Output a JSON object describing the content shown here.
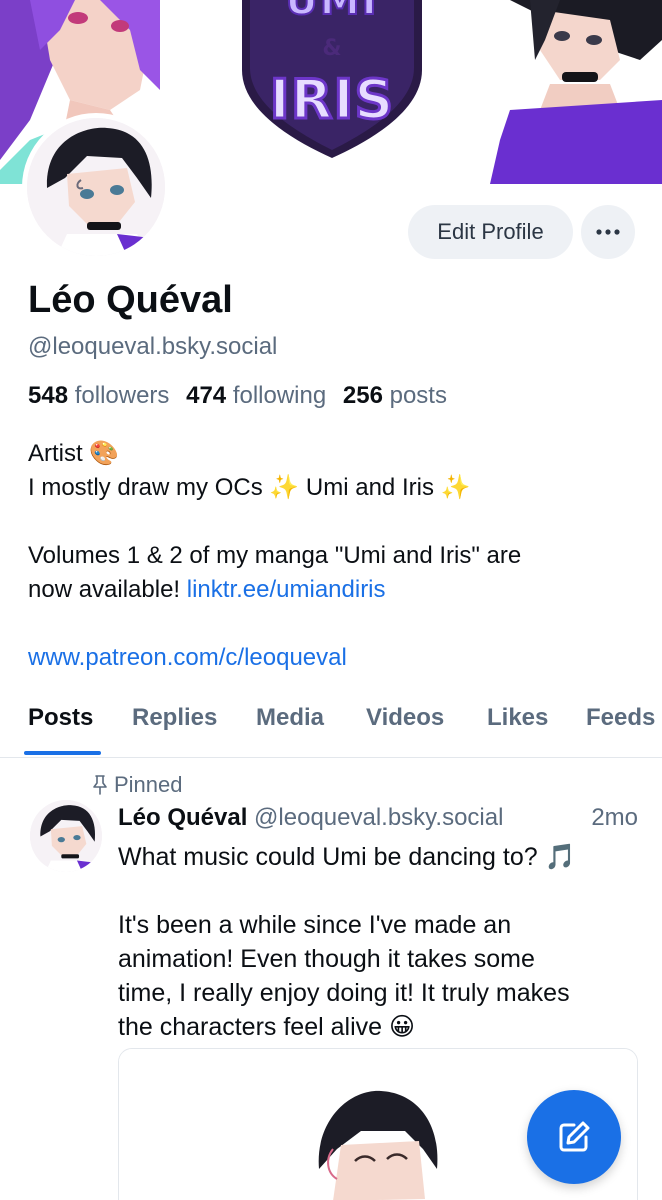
{
  "banner": {
    "logo_top": "UMI",
    "logo_amp": "&",
    "logo_bottom": "IRIS"
  },
  "actions": {
    "edit_label": "Edit Profile"
  },
  "profile": {
    "name": "Léo Quéval",
    "handle": "@leoqueval.bsky.social",
    "followers_count": "548",
    "followers_label": "followers",
    "following_count": "474",
    "following_label": "following",
    "posts_count": "256",
    "posts_label": "posts",
    "bio_line1": "Artist 🎨",
    "bio_line2": "I mostly draw my OCs ✨ Umi and Iris ✨",
    "bio_line3": "Volumes 1 & 2 of my manga \"Umi and Iris\" are",
    "bio_line4_text": "now available! ",
    "bio_line4_link": "linktr.ee/umiandiris",
    "bio_link2": "www.patreon.com/c/leoqueval"
  },
  "tabs": [
    "Posts",
    "Replies",
    "Media",
    "Videos",
    "Likes",
    "Feeds"
  ],
  "post": {
    "pinned_label": "Pinned",
    "author": "Léo Quéval",
    "handle": "@leoqueval.bsky.social",
    "time": "2mo",
    "line1": "What music could Umi be dancing to? 🎵",
    "line2": "It's been a while since I've made an",
    "line3": "animation! Even though it takes some",
    "line4": "time, I really enjoy doing it! It truly makes",
    "line5": "the characters feel alive 😀"
  },
  "icons": {
    "more": "ellipsis-icon",
    "pin": "pin-icon",
    "compose": "compose-icon"
  },
  "colors": {
    "accent": "#1a70e6",
    "muted": "#5b6b7e",
    "button_bg": "#eef1f5"
  }
}
